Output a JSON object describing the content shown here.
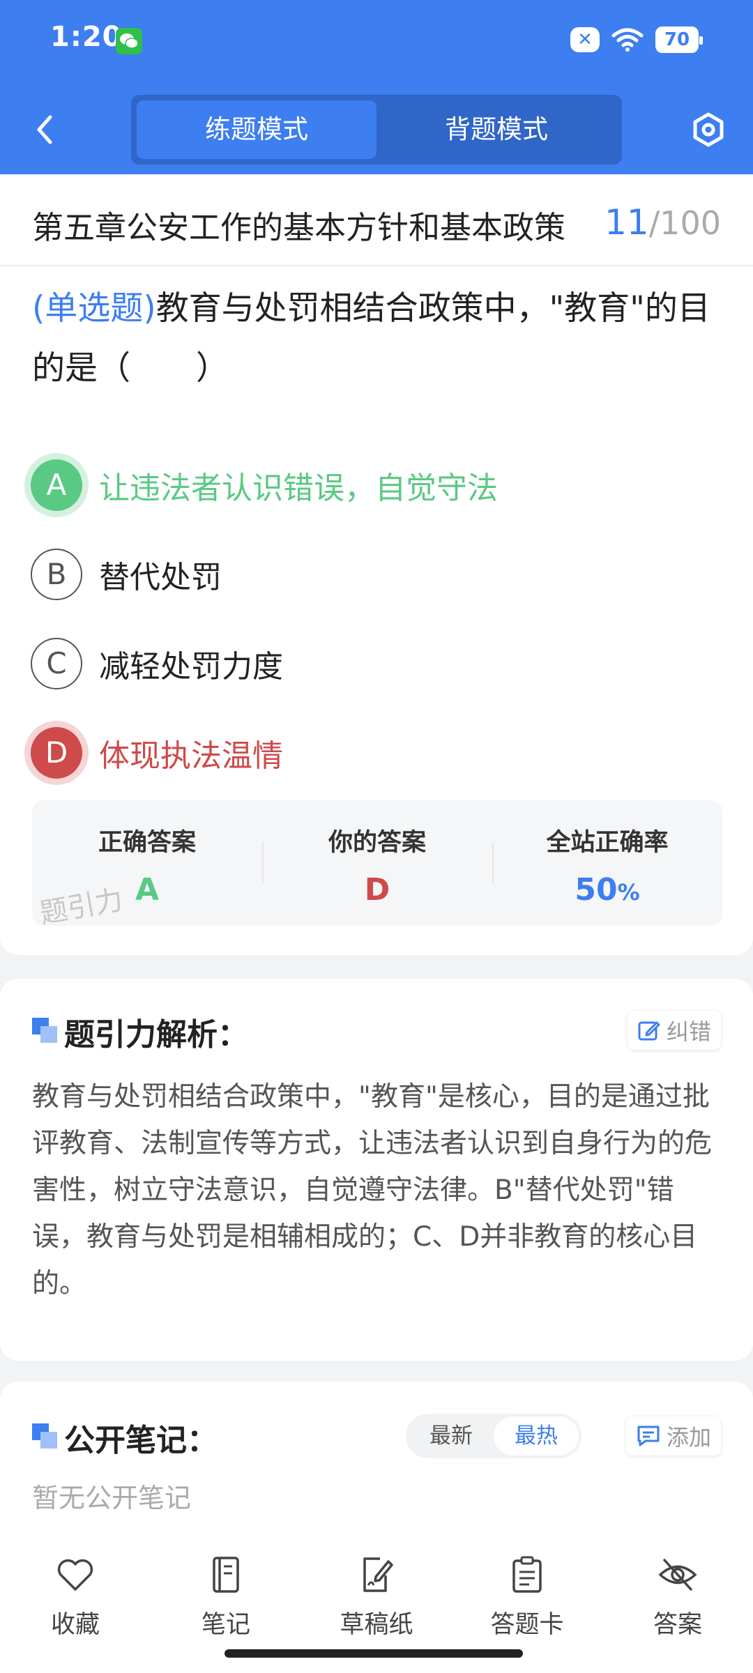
{
  "status_bar": {
    "time": "1:20",
    "x_badge": "✕",
    "battery": "70"
  },
  "header": {
    "tabs": [
      {
        "label": "练题模式",
        "active": true
      },
      {
        "label": "背题模式",
        "active": false
      }
    ]
  },
  "chapter": {
    "title": "第五章公安工作的基本方针和基本政策",
    "current": "11",
    "total": "/100"
  },
  "question": {
    "type": "(单选题)",
    "text": "教育与处罚相结合政策中，\"教育\"的目的是（　　）"
  },
  "options": [
    {
      "letter": "A",
      "text": "让违法者认识错误，自觉守法",
      "state": "correct"
    },
    {
      "letter": "B",
      "text": "替代处罚",
      "state": "normal"
    },
    {
      "letter": "C",
      "text": "减轻处罚力度",
      "state": "normal"
    },
    {
      "letter": "D",
      "text": "体现执法温情",
      "state": "wrong"
    }
  ],
  "stats": {
    "correct_label": "正确答案",
    "correct_value": "A",
    "yours_label": "你的答案",
    "yours_value": "D",
    "rate_label": "全站正确率",
    "rate_value": "50",
    "rate_unit": "%",
    "watermark": "题引力"
  },
  "analysis": {
    "title": "题引力解析：",
    "correct_btn": "纠错",
    "text": "教育与处罚相结合政策中，\"教育\"是核心，目的是通过批评教育、法制宣传等方式，让违法者认识到自身行为的危害性，树立守法意识，自觉遵守法律。B\"替代处罚\"错误，教育与处罚是相辅相成的；C、D并非教育的核心目的。"
  },
  "notes": {
    "title": "公开笔记：",
    "sort_latest": "最新",
    "sort_hot": "最热",
    "add_btn": "添加",
    "empty": "暂无公开笔记"
  },
  "bottom_nav": [
    {
      "label": "收藏",
      "icon": "heart-icon"
    },
    {
      "label": "笔记",
      "icon": "notebook-icon"
    },
    {
      "label": "草稿纸",
      "icon": "draft-icon"
    },
    {
      "label": "答题卡",
      "icon": "answer-sheet-icon"
    },
    {
      "label": "答案",
      "icon": "eye-off-icon"
    }
  ],
  "colors": {
    "primary": "#3d7ef0",
    "correct": "#5ac984",
    "wrong": "#cf4a4a"
  }
}
